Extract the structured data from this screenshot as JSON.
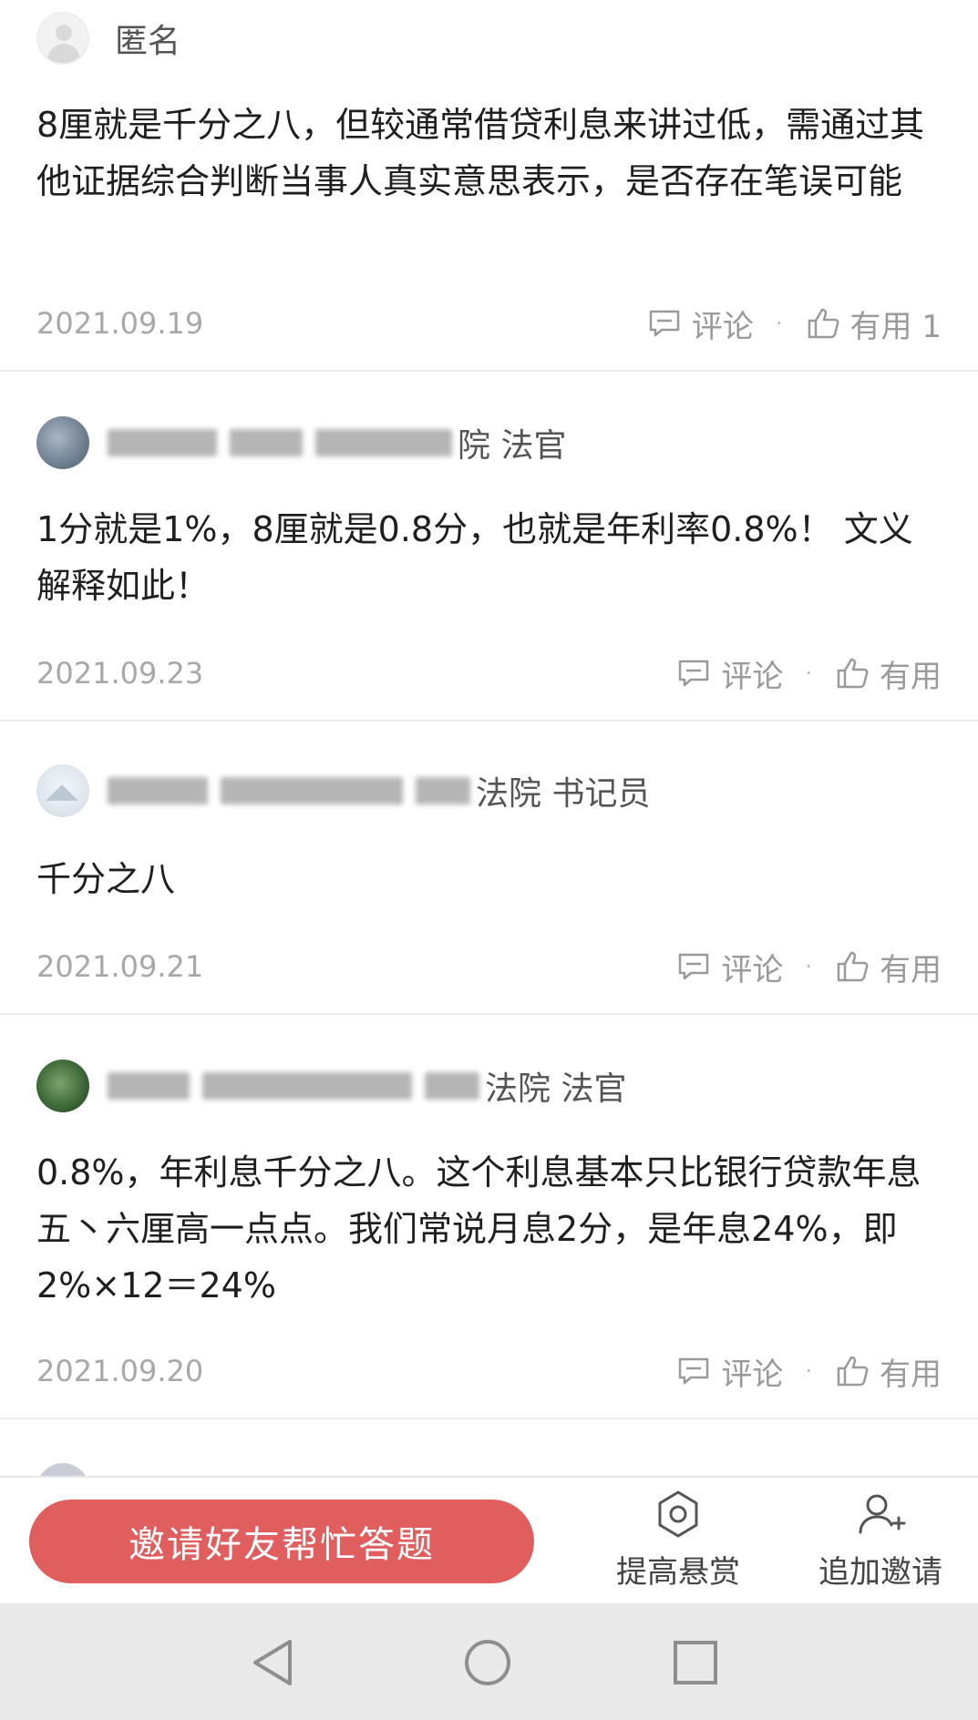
{
  "answers": [
    {
      "author_name": "匿名",
      "author_suffix": "",
      "content": "8厘就是千分之八，但较通常借贷利息来讲过低，需通过其他证据综合判断当事人真实意思表示，是否存在笔误可能",
      "date": "2021.09.19",
      "comment_label": "评论",
      "useful_label": "有用 1"
    },
    {
      "author_name": "",
      "author_suffix": "院  法官",
      "content": "1分就是1%，8厘就是0.8分，也就是年利率0.8%！ 文义解释如此！",
      "date": "2021.09.23",
      "comment_label": "评论",
      "useful_label": "有用"
    },
    {
      "author_name": "",
      "author_suffix": "法院  书记员",
      "content": "千分之八",
      "date": "2021.09.21",
      "comment_label": "评论",
      "useful_label": "有用"
    },
    {
      "author_name": "",
      "author_suffix": "法院  法官",
      "content": "0.8%，年利息千分之八。这个利息基本只比银行贷款年息五丶六厘高一点点。我们常说月息2分，是年息24%，即2%×12＝24%",
      "date": "2021.09.20",
      "comment_label": "评论",
      "useful_label": "有用"
    }
  ],
  "bottom_bar": {
    "invite_label": "邀请好友帮忙答题",
    "raise_reward_label": "提高悬赏",
    "add_invite_label": "追加邀请"
  },
  "icons": {
    "comment": "comment-icon",
    "like": "thumbs-up-icon",
    "reward": "reward-gear-icon",
    "add_user": "add-user-icon",
    "back": "back-triangle-icon",
    "home": "home-circle-icon",
    "recents": "recents-square-icon"
  },
  "colors": {
    "accent": "#e15e5e",
    "meta_text": "#a8a8a8",
    "nav_bg": "#e9e9e9"
  }
}
